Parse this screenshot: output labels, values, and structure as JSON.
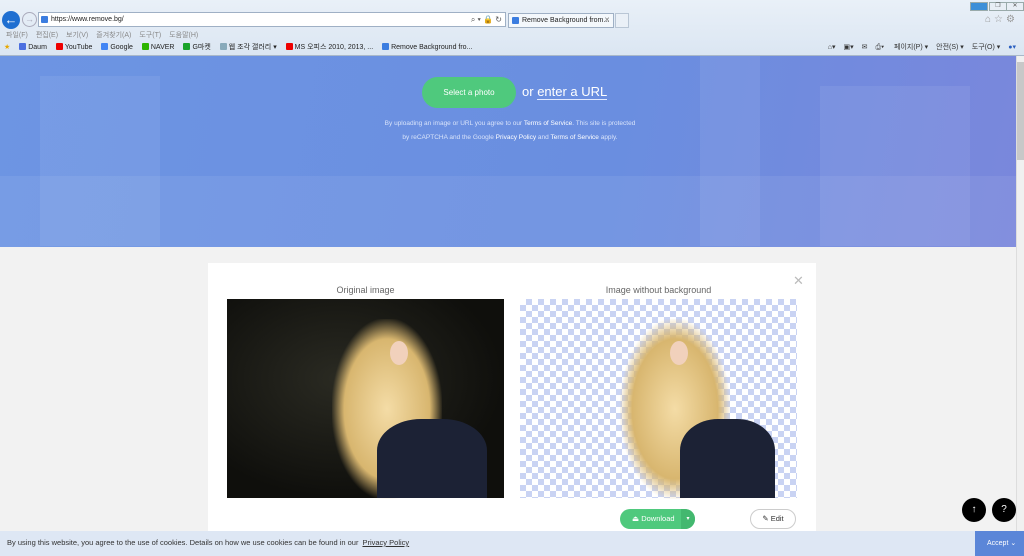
{
  "browser": {
    "url": "https://www.remove.bg/",
    "tab_title": "Remove Background from...",
    "menu": [
      "파일(F)",
      "편집(E)",
      "보기(V)",
      "즐겨찾기(A)",
      "도구(T)",
      "도움말(H)"
    ],
    "favorites": [
      "Daum",
      "YouTube",
      "Google",
      "NAVER",
      "G마켓",
      "웹 조각 갤러리 ▾",
      "MS 오피스 2010, 2013, ...",
      "Remove Background fro..."
    ],
    "command_bar": [
      "페이지(P) ▾",
      "안전(S) ▾",
      "도구(O) ▾"
    ]
  },
  "hero": {
    "select_label": "Select a photo",
    "or_text": "or",
    "url_link": "enter a URL",
    "legal": {
      "t1": "By uploading an image or URL you agree to our",
      "tos": "Terms of Service",
      "t2": ". This site is protected",
      "t3": "by reCAPTCHA and the Google",
      "pp": "Privacy Policy",
      "t4": "and",
      "tos2": "Terms of Service",
      "t5": "apply."
    }
  },
  "result": {
    "original_title": "Original image",
    "removed_title": "Image without background",
    "download_label": "Download",
    "edit_label": "Edit"
  },
  "cookie": {
    "text": "By using this website, you agree to the use of cookies. Details on how we use cookies can be found in our",
    "link": "Privacy Policy",
    "accept": "Accept"
  },
  "colors": {
    "accent_green": "#4fc97d",
    "hero_blue": "#6d95e3",
    "accept_blue": "#5b86d8"
  }
}
